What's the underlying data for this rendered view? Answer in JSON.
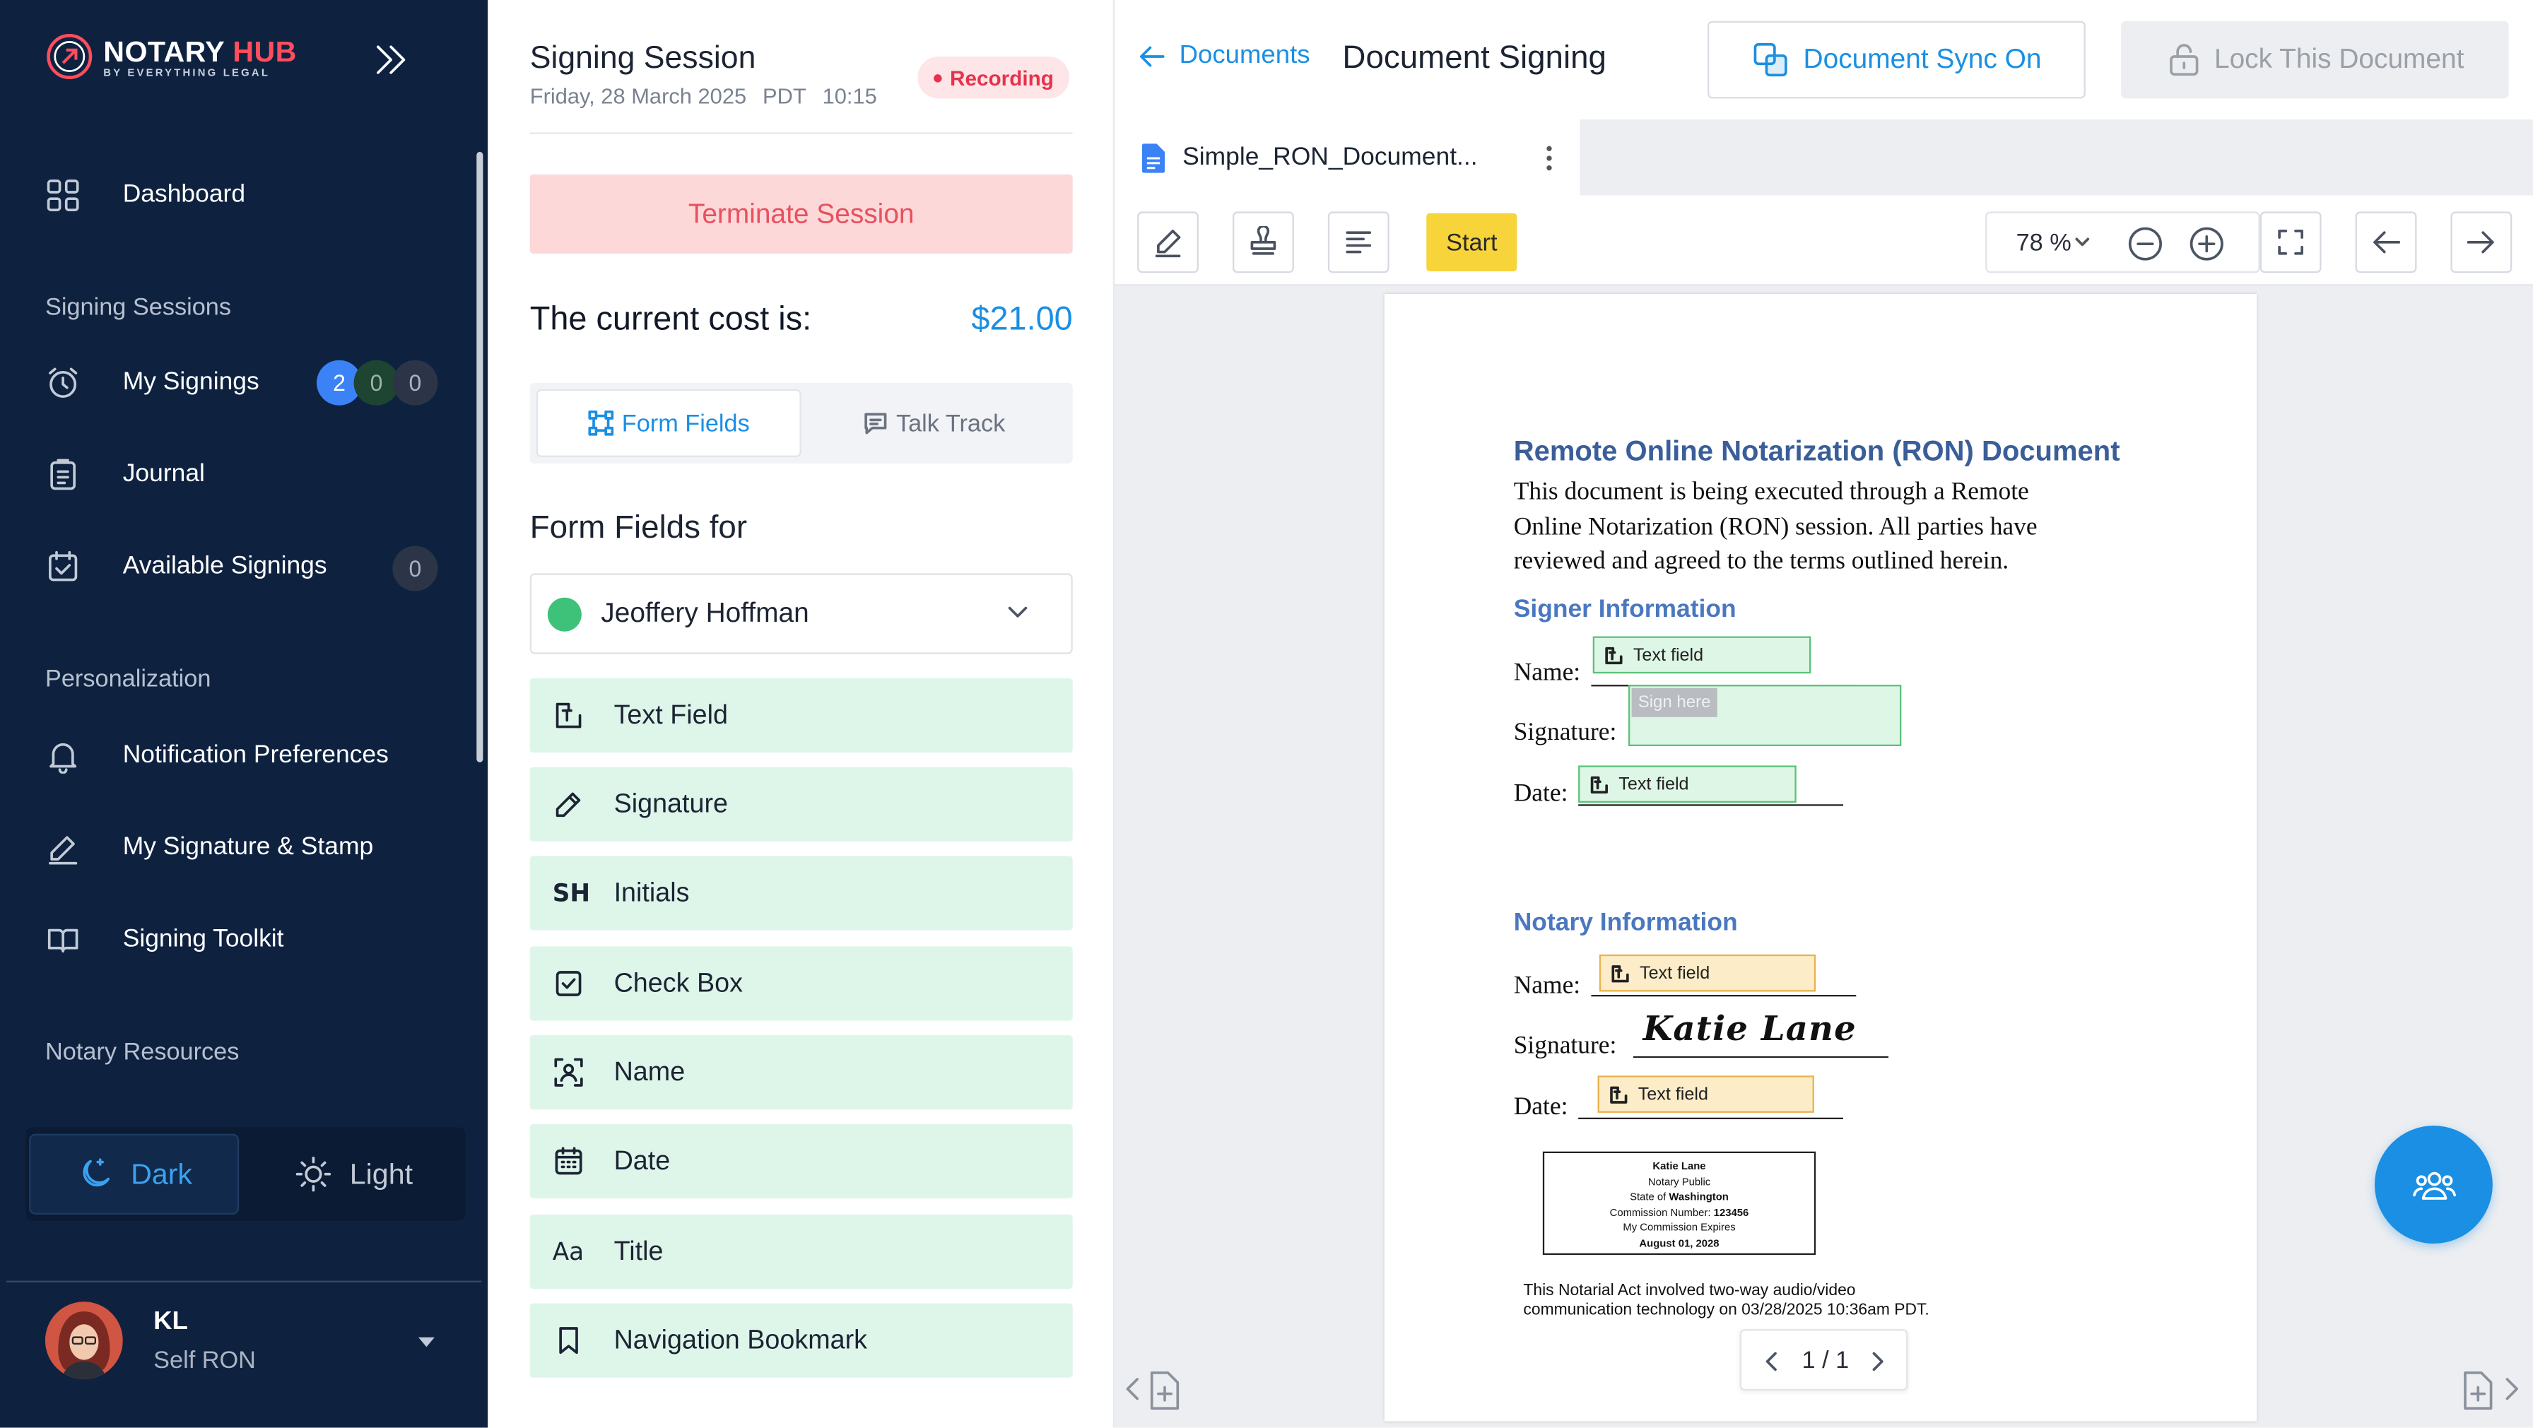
{
  "sidebar": {
    "brand_main": "NOTARY",
    "brand_accent": "HUB",
    "brand_sub": "BY EVERYTHING LEGAL",
    "items": {
      "dashboard": "Dashboard",
      "signing_sessions": "Signing Sessions",
      "my_signings": "My Signings",
      "journal": "Journal",
      "available_signings": "Available Signings",
      "personalization": "Personalization",
      "notification_preferences": "Notification Preferences",
      "my_signature_stamp": "My Signature & Stamp",
      "signing_toolkit": "Signing Toolkit",
      "notary_resources": "Notary Resources"
    },
    "my_signings_counts": [
      "2",
      "0",
      "0"
    ],
    "available_signings_count": "0",
    "theme": {
      "dark": "Dark",
      "light": "Light"
    },
    "user": {
      "initials": "KL",
      "role": "Self RON"
    }
  },
  "session": {
    "title": "Signing Session",
    "date": "Friday, 28 March 2025",
    "tz": "PDT",
    "time": "10:15",
    "recording_badge": "Recording",
    "terminate_label": "Terminate Session",
    "cost_label": "The current cost is:",
    "cost_value": "$21.00",
    "tabs": {
      "form_fields": "Form Fields",
      "talk_track": "Talk Track"
    },
    "form_fields_for": "Form Fields for",
    "signer": "Jeoffery Hoffman",
    "fields": [
      "Text Field",
      "Signature",
      "Initials",
      "Check Box",
      "Name",
      "Date",
      "Title",
      "Navigation Bookmark"
    ]
  },
  "doc": {
    "back_label": "Documents",
    "title": "Document Signing",
    "sync_label": "Document Sync On",
    "lock_label": "Lock This Document",
    "file_tab": "Simple_RON_Document...",
    "start_label": "Start",
    "zoom": "78 %",
    "page_indicator": "1 / 1",
    "content": {
      "heading": "Remote Online Notarization (RON) Document",
      "intro_1": "This document is being executed through a Remote",
      "intro_2": "Online Notarization (RON) session. All parties have",
      "intro_3": "reviewed and agreed to the terms outlined herein.",
      "signer_heading": "Signer Information",
      "notary_heading": "Notary Information",
      "name_label": "Name:",
      "signature_label": "Signature:",
      "date_label": "Date:",
      "text_field_ph": "Text field",
      "sign_here_ph": "Sign here",
      "notary_signature": "Katie Lane",
      "stamp": {
        "name": "Katie Lane",
        "title": "Notary Public",
        "state_prefix": "State of",
        "state": "Washington",
        "commission_prefix": "Commission Number:",
        "commission": "123456",
        "expires_label": "My Commission Expires",
        "expires": "August 01, 2028"
      },
      "footer_1": "This Notarial Act involved two-way audio/video",
      "footer_2": "communication technology on 03/28/2025 10:36am PDT."
    }
  },
  "colors": {
    "sidebar": "#0e2240",
    "accent": "#1a8fe3",
    "field_bg": "#def6ea",
    "recording": "#e8324a",
    "start": "#f7d43a"
  }
}
